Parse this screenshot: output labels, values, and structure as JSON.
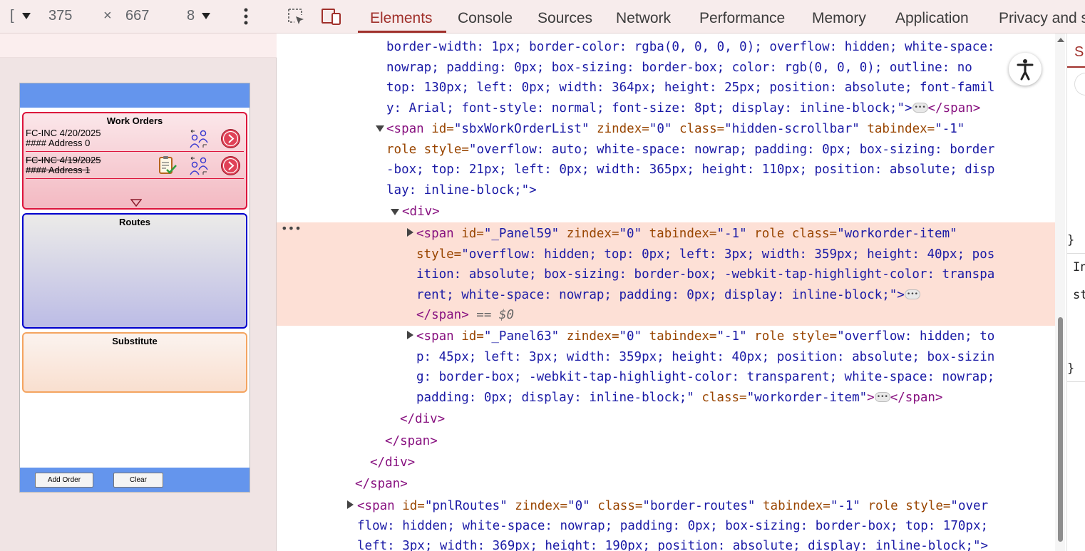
{
  "device_toolbar": {
    "dimension_prefix": "[",
    "width": "375",
    "times": "×",
    "height": "667",
    "zoom_partial": "8"
  },
  "app": {
    "work_orders": {
      "title": "Work Orders",
      "items": [
        {
          "line1": "FC-INC 4/20/2025",
          "line2": "#### Address 0",
          "struck": false
        },
        {
          "line1": "FC-INC 4/19/2025",
          "line2": "#### Address 1",
          "struck": true
        }
      ]
    },
    "routes": {
      "title": "Routes"
    },
    "substitute": {
      "title": "Substitute"
    },
    "buttons": {
      "add_order": "Add Order",
      "clear": "Clear"
    }
  },
  "devtools": {
    "tabs": [
      "Elements",
      "Console",
      "Sources",
      "Network",
      "Performance",
      "Memory",
      "Application",
      "Privacy and s"
    ],
    "active_tab": "Elements",
    "styles_pane_chars": [
      "S",
      "}",
      "In",
      "st",
      "}"
    ],
    "dom_lines": {
      "l0": "border-width: 1px; border-color: rgba(0, 0, 0, 0); overflow: hidden; white-space:",
      "l1": "nowrap; padding: 0px; box-sizing: border-box; color: rgb(0, 0, 0); outline: no",
      "l2": "top: 130px; left: 0px; width: 364px; height: 25px; position: absolute; font-famil",
      "l3a": "y: Arial; font-style: normal; font-size: 8pt; display: inline-block;\">",
      "l3b": "</span>",
      "l4_tag": "<span",
      "l4_rest_attr1": " id=",
      "l4_rest_val1": "\"sbxWorkOrderList\"",
      "l4_rest_attr2": " zindex=",
      "l4_rest_val2": "\"0\"",
      "l4_rest_attr3": " class=",
      "l4_rest_val3": "\"hidden-scrollbar\"",
      "l4_rest_attr4": " tabindex=",
      "l4_rest_val4": "\"-1\"",
      "l5_attr": "role style=",
      "l5_val": "\"overflow: auto; white-space: nowrap; padding: 0px; box-sizing: border",
      "l6": "-box; top: 21px; left: 0px; width: 365px; height: 110px; position: absolute; disp",
      "l7": "lay: inline-block;\">",
      "l8": "<div>",
      "l9_tag": "<span",
      "l9_attr1": " id=",
      "l9_val1": "\"_Panel59\"",
      "l9_attr2": " zindex=",
      "l9_val2": "\"0\"",
      "l9_attr3": " tabindex=",
      "l9_val3": "\"-1\"",
      "l9_attr4": " role class=",
      "l9_val4": "\"workorder-item\"",
      "l10_attr": "style=",
      "l10_val": "\"overflow: hidden; top: 0px; left: 3px; width: 359px; height: 40px; pos",
      "l11": "ition: absolute; box-sizing: border-box; -webkit-tap-highlight-color: transpa",
      "l12": "rent; white-space: nowrap; padding: 0px; display: inline-block;\">",
      "l13_tag": "</span>",
      "l13_eq": " == $0",
      "l14_tag": "<span",
      "l14_attr1": " id=",
      "l14_val1": "\"_Panel63\"",
      "l14_attr2": " zindex=",
      "l14_val2": "\"0\"",
      "l14_attr3": " tabindex=",
      "l14_val3": "\"-1\"",
      "l14_attr4": " role style=",
      "l14_val4": "\"overflow: hidden; to",
      "l15": "p: 45px; left: 3px; width: 359px; height: 40px; position: absolute; box-sizin",
      "l16": "g: border-box; -webkit-tap-highlight-color: transparent; white-space: nowrap;",
      "l17_val": "padding: 0px; display: inline-block;\"",
      "l17_attr": " class=",
      "l17_val2": "\"workorder-item\"",
      "l17_tag": "</span>",
      "l18": "</div>",
      "l19": "</span>",
      "l20": "</div>",
      "l21": "</span>",
      "l22_tag": "<span",
      "l22_attr1": " id=",
      "l22_val1": "\"pnlRoutes\"",
      "l22_attr2": " zindex=",
      "l22_val2": "\"0\"",
      "l22_attr3": " class=",
      "l22_val3": "\"border-routes\"",
      "l22_attr4": " tabindex=",
      "l22_val4": "\"-1\"",
      "l22_attr5": " role style=",
      "l22_val5": "\"over",
      "l23": "flow: hidden; white-space: nowrap; padding: 0px; box-sizing: border-box; top: 170px;",
      "l24": "left: 3px; width: 369px; height: 190px; position: absolute; display: inline-block;\">"
    }
  }
}
